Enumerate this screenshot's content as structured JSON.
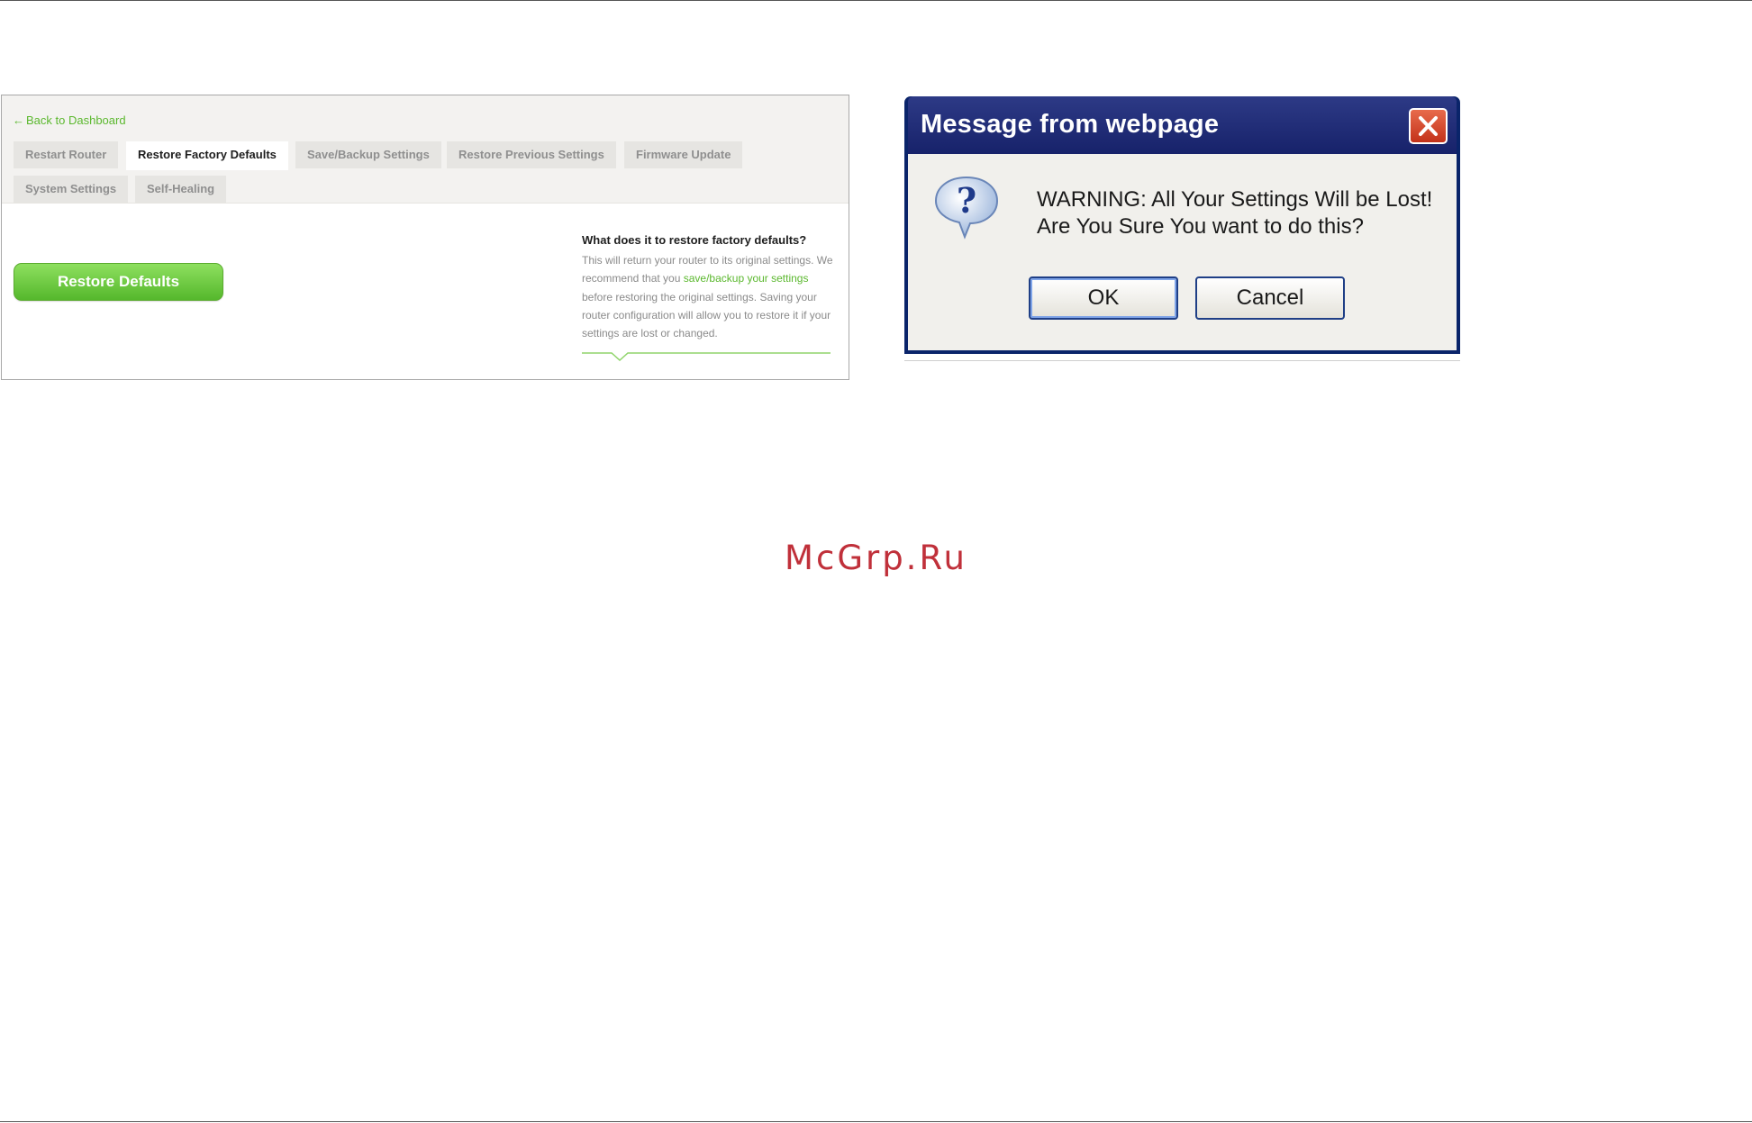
{
  "router_panel": {
    "back_link": {
      "arrow": "←",
      "label": "Back to Dashboard"
    },
    "tabs": [
      {
        "label": "Restart Router",
        "active": false
      },
      {
        "label": "Restore Factory Defaults",
        "active": true
      },
      {
        "label": "Save/Backup Settings",
        "active": false
      },
      {
        "label": "Restore Previous Settings",
        "active": false
      },
      {
        "label": "Firmware Update",
        "active": false
      },
      {
        "label": "System Settings",
        "active": false
      },
      {
        "label": "Self-Healing",
        "active": false
      }
    ],
    "restore_button_label": "Restore Defaults",
    "help": {
      "title": "What does it to restore factory defaults?",
      "text_1": "This will return your router to its original settings. We recommend that you ",
      "link_text": "save/backup your settings",
      "text_2": " before restoring the original settings. Saving your router configuration will allow you to restore it if your settings are lost or changed."
    },
    "colors": {
      "accent_green": "#5bb82e",
      "header_bg": "#f3f2f0"
    }
  },
  "dialog": {
    "title": "Message from webpage",
    "message_line_1": "WARNING: All Your Settings Will be Lost!",
    "message_line_2": "Are You Sure You want to do this?",
    "ok_label": "OK",
    "cancel_label": "Cancel",
    "icons": {
      "question": "question-icon",
      "close": "close-icon"
    }
  },
  "watermark": "McGrp.Ru"
}
